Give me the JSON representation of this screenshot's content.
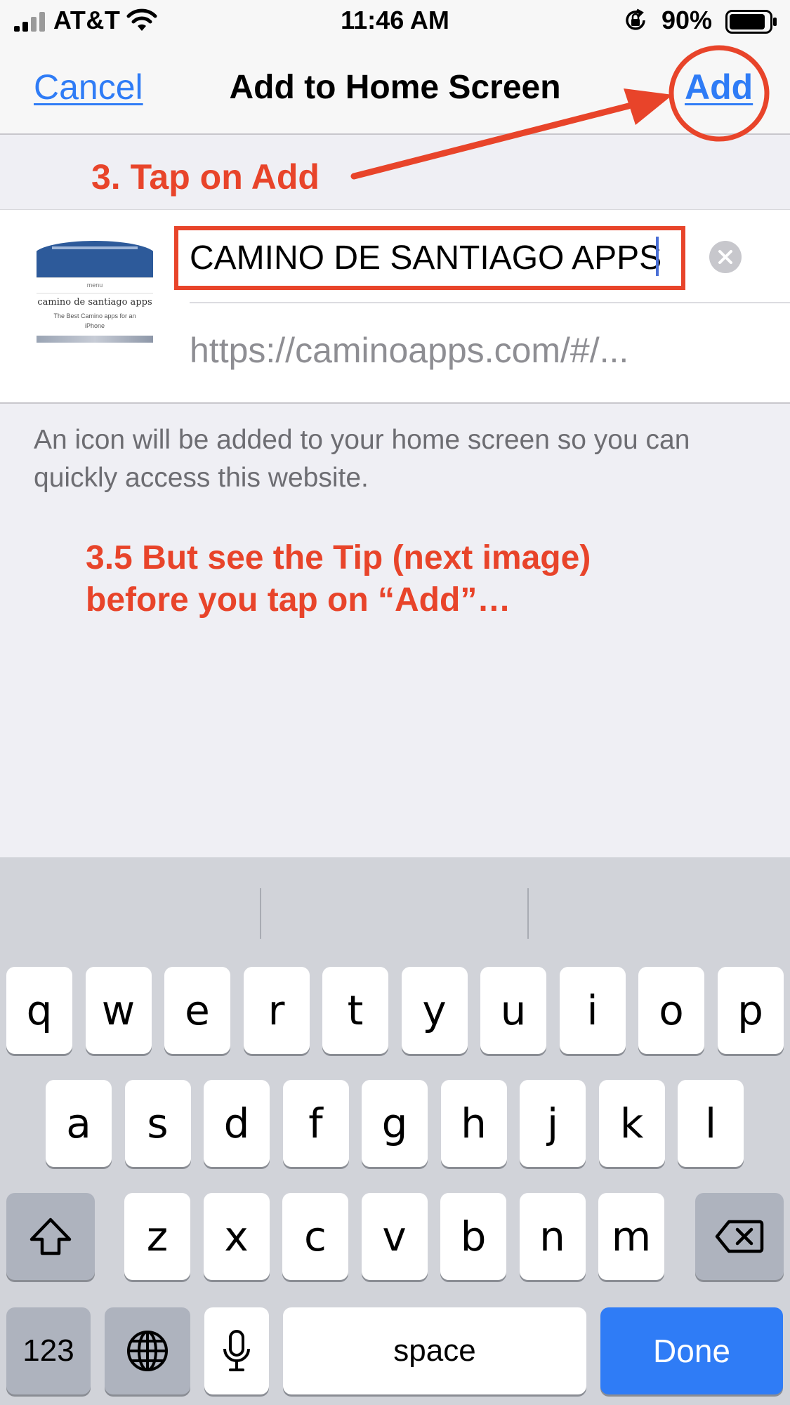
{
  "status_bar": {
    "carrier": "AT&T",
    "time": "11:46 AM",
    "battery_percent": "90%",
    "battery_level": 0.9,
    "icons": [
      "cellular-signal-icon",
      "wifi-icon",
      "orientation-lock-icon",
      "battery-icon"
    ]
  },
  "nav": {
    "cancel_label": "Cancel",
    "title": "Add to Home Screen",
    "add_label": "Add"
  },
  "annotations": {
    "step3": "3. Tap on Add",
    "step35_line1": "3.5 But see the Tip (next image)",
    "step35_line2": "before you tap on “Add”…",
    "color": "#e8442a"
  },
  "form": {
    "name_value": "CAMINO DE SANTIAGO APPS",
    "url": "https://caminoapps.com/#/...",
    "thumbnail": {
      "subtitle": "menu",
      "title": "camino de santiago apps",
      "text_line1": "The Best Camino apps for an",
      "text_line2": "iPhone"
    }
  },
  "description": "An icon will be added to your home screen so you can quickly access this website.",
  "keyboard": {
    "row1": [
      "q",
      "w",
      "e",
      "r",
      "t",
      "y",
      "u",
      "i",
      "o",
      "p"
    ],
    "row2": [
      "a",
      "s",
      "d",
      "f",
      "g",
      "h",
      "j",
      "k",
      "l"
    ],
    "row3": [
      "z",
      "x",
      "c",
      "v",
      "b",
      "n",
      "m"
    ],
    "numbers_label": "123",
    "space_label": "space",
    "done_label": "Done",
    "icons": [
      "shift-icon",
      "backspace-icon",
      "globe-icon",
      "microphone-icon"
    ]
  },
  "colors": {
    "ios_blue": "#2f7cf6",
    "annotation_red": "#e8442a",
    "background": "#efeff4"
  }
}
